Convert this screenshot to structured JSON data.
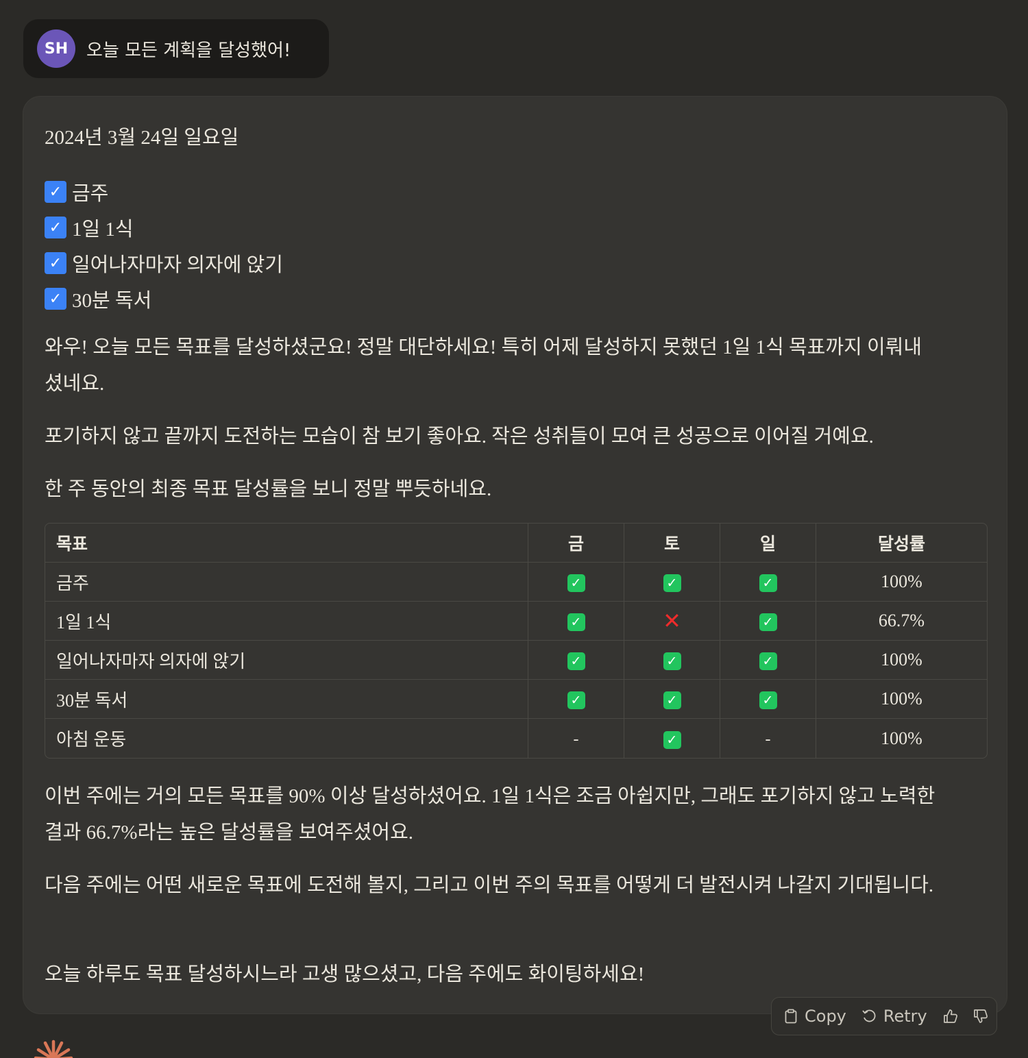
{
  "user_message": {
    "avatar_initials": "SH",
    "text": "오늘 모든 계획을 달성했어!"
  },
  "assistant": {
    "date": "2024년 3월 24일 일요일",
    "checklist": [
      "금주",
      "1일 1식",
      "일어나자마자 의자에 앉기",
      "30분 독서"
    ],
    "paragraphs": [
      "와우! 오늘 모든 목표를 달성하셨군요! 정말 대단하세요! 특히 어제 달성하지 못했던 1일 1식 목표까지 이뤄내셨네요.",
      "포기하지 않고 끝까지 도전하는 모습이 참 보기 좋아요. 작은 성취들이 모여 큰 성공으로 이어질 거예요.",
      "한 주 동안의 최종 목표 달성률을 보니 정말 뿌듯하네요.",
      "이번 주에는 거의 모든 목표를 90% 이상 달성하셨어요. 1일 1식은 조금 아쉽지만, 그래도 포기하지 않고 노력한 결과 66.7%라는 높은 달성률을 보여주셨어요.",
      "다음 주에는 어떤 새로운 목표에 도전해 볼지, 그리고 이번 주의 목표를 어떻게 더 발전시켜 나갈지 기대됩니다.",
      "오늘 하루도 목표 달성하시느라 고생 많으셨고, 다음 주에도 화이팅하세요!"
    ],
    "table": {
      "headers": [
        "목표",
        "금",
        "토",
        "일",
        "달성률"
      ],
      "rows": [
        {
          "goal": "금주",
          "fri": "done",
          "sat": "done",
          "sun": "done",
          "rate": "100%"
        },
        {
          "goal": "1일 1식",
          "fri": "done",
          "sat": "missed",
          "sun": "done",
          "rate": "66.7%"
        },
        {
          "goal": "일어나자마자 의자에 앉기",
          "fri": "done",
          "sat": "done",
          "sun": "done",
          "rate": "100%"
        },
        {
          "goal": "30분 독서",
          "fri": "done",
          "sat": "done",
          "sun": "done",
          "rate": "100%"
        },
        {
          "goal": "아침 운동",
          "fri": "-",
          "sat": "done",
          "sun": "-",
          "rate": "100%"
        }
      ]
    }
  },
  "actions": {
    "copy_label": "Copy",
    "retry_label": "Retry"
  },
  "icons": {
    "checkbox": "checked-checkbox-icon",
    "done": "green-check-icon",
    "missed": "red-x-icon",
    "copy": "clipboard-icon",
    "retry": "retry-arrow-icon",
    "thumbs_up": "thumbs-up-icon",
    "thumbs_down": "thumbs-down-icon",
    "logo": "claude-spark-icon"
  },
  "colors": {
    "background": "#2b2a27",
    "card": "#353431",
    "avatar": "#6b56b8",
    "checkbox": "#3b82f6",
    "done": "#22c55e",
    "missed": "#ef2b2b",
    "logo": "#d97757"
  }
}
